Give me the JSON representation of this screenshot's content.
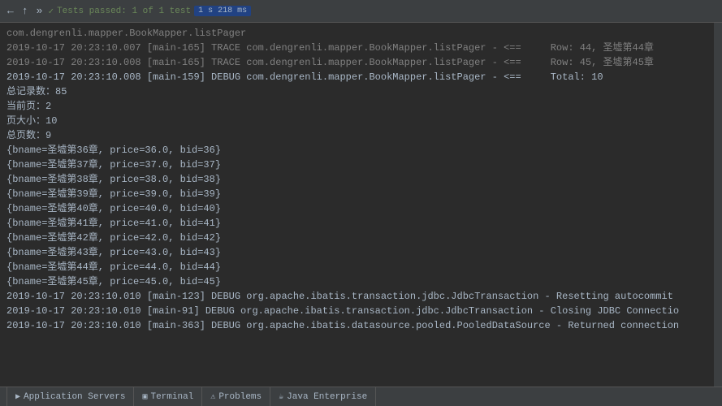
{
  "topbar": {
    "icons": [
      "←",
      "↑",
      "»"
    ],
    "green_check": "✓",
    "tests_passed": "Tests passed: 1 of 1 test",
    "timing": "1 s 218 ms"
  },
  "log": {
    "truncated_top": "com.dengrenli.mapper.BookMapper.listPager",
    "lines": [
      {
        "id": 1,
        "timestamp": "2019-10-17 20:23:10.007",
        "thread": "[main-165]",
        "level": "TRACE",
        "logger": "com.dengrenli.mapper.BookMapper.listPager",
        "arrow": "<==",
        "rowinfo": "Row: 44, 圣墟第44章"
      },
      {
        "id": 2,
        "timestamp": "2019-10-17 20:23:10.008",
        "thread": "[main-165]",
        "level": "TRACE",
        "logger": "com.dengrenli.mapper.BookMapper.listPager",
        "arrow": "<==",
        "rowinfo": "Row: 45, 圣墟第45章"
      },
      {
        "id": 3,
        "timestamp": "2019-10-17 20:23:10.008",
        "thread": "[main-159]",
        "level": "DEBUG",
        "logger": "com.dengrenli.mapper.BookMapper.listPager",
        "arrow": "<==",
        "rowinfo": "Total: 10"
      }
    ],
    "summary": {
      "total_records_label": "总记录数：",
      "total_records_value": "85",
      "current_page_label": "当前页：",
      "current_page_value": "2",
      "page_size_label": "页大小：",
      "page_size_value": "10",
      "total_pages_label": "总页数：",
      "total_pages_value": "9"
    },
    "books": [
      "{bname=圣墟第36章, price=36.0, bid=36}",
      "{bname=圣墟第37章, price=37.0, bid=37}",
      "{bname=圣墟第38章, price=38.0, bid=38}",
      "{bname=圣墟第39章, price=39.0, bid=39}",
      "{bname=圣墟第40章, price=40.0, bid=40}",
      "{bname=圣墟第41章, price=41.0, bid=41}",
      "{bname=圣墟第42章, price=42.0, bid=42}",
      "{bname=圣墟第43章, price=43.0, bid=43}",
      "{bname=圣墟第44章, price=44.0, bid=44}",
      "{bname=圣墟第45章, price=45.0, bid=45}"
    ],
    "footer_lines": [
      {
        "timestamp": "2019-10-17 20:23:10.010",
        "thread": "[main-123]",
        "level": "DEBUG",
        "message": "org.apache.ibatis.transaction.jdbc.JdbcTransaction - Resetting autocommit"
      },
      {
        "timestamp": "2019-10-17 20:23:10.010",
        "thread": "[main-91]",
        "level": "DEBUG",
        "message": "org.apache.ibatis.transaction.jdbc.JdbcTransaction - Closing JDBC Connectio"
      },
      {
        "timestamp": "2019-10-17 20:23:10.010",
        "thread": "[main-363]",
        "level": "DEBUG",
        "message": "org.apache.ibatis.datasource.pooled.PooledDataSource - Returned connection"
      }
    ]
  },
  "statusbar": {
    "items": [
      {
        "icon": "▶",
        "label": "Application Servers"
      },
      {
        "icon": "▣",
        "label": "Terminal"
      },
      {
        "icon": "⚠",
        "label": "Problems"
      },
      {
        "icon": "☕",
        "label": "Java Enterprise"
      }
    ]
  }
}
